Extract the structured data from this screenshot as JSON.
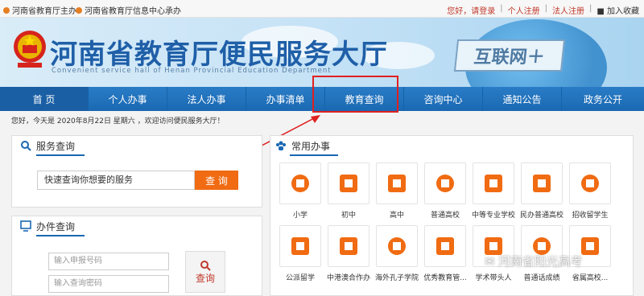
{
  "topbar": {
    "sponsor1": "河南省教育厅主办",
    "sponsor2": "河南省教育厅信息中心承办",
    "greeting": "您好，请登录",
    "personal_register": "个人注册",
    "legal_register": "法人注册",
    "add_favorite": "加入收藏",
    "sep": "|"
  },
  "banner": {
    "title": "河南省教育厅便民服务大厅",
    "subtitle": "Convenient service hall of Henan Provincial Education Department",
    "internet_plus": "互联网＋"
  },
  "nav": {
    "items": [
      "首 页",
      "个人办事",
      "法人办事",
      "办事清单",
      "教育查询",
      "咨询中心",
      "通知公告",
      "政务公开"
    ]
  },
  "welcome": "您好，今天是 2020年8月22日 星期六 ，欢迎访问便民服务大厅！",
  "service_query": {
    "title": "服务查询",
    "placeholder": "快速查询你想要的服务",
    "button": "查 询"
  },
  "case_query": {
    "title": "办件查询",
    "input1_placeholder": "输入申报号码",
    "input2_placeholder": "输入查询密码",
    "button": "查询"
  },
  "common": {
    "title": "常用办事",
    "items": [
      "小学",
      "初中",
      "高中",
      "普通高校",
      "中等专业学校",
      "民办普通高校",
      "招收留学生",
      "公派留学",
      "中港澳合作办",
      "海外孔子学院",
      "优秀教育管...",
      "学术带头人",
      "普通话成绩",
      "省属高校..."
    ]
  },
  "watermark": "河南省阳光高考",
  "colors": {
    "nav_blue": "#1a68b2",
    "accent_orange": "#f06b12",
    "highlight_red": "#e02020"
  }
}
